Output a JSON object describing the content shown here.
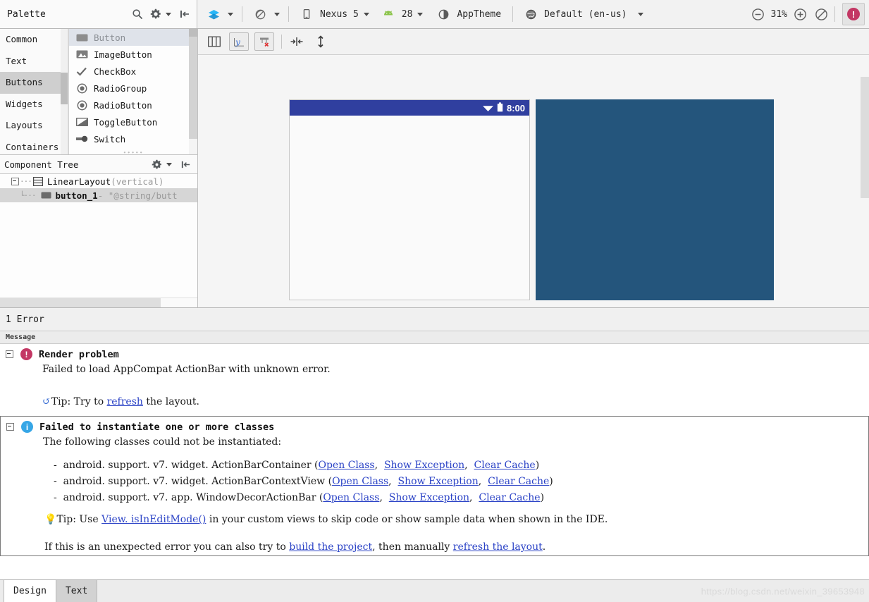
{
  "palette": {
    "title": "Palette",
    "icons": {
      "search": "search-icon",
      "gear": "gear-icon",
      "collapse": "collapse-panel-icon"
    },
    "categories": [
      {
        "label": "Common",
        "selected": false
      },
      {
        "label": "Text",
        "selected": false
      },
      {
        "label": "Buttons",
        "selected": true
      },
      {
        "label": "Widgets",
        "selected": false
      },
      {
        "label": "Layouts",
        "selected": false
      },
      {
        "label": "Containers",
        "selected": false
      }
    ],
    "widgets": [
      {
        "label": "Button",
        "icon": "button-icon",
        "selected": true
      },
      {
        "label": "ImageButton",
        "icon": "image-button-icon",
        "selected": false
      },
      {
        "label": "CheckBox",
        "icon": "checkbox-icon",
        "selected": false
      },
      {
        "label": "RadioGroup",
        "icon": "radio-group-icon",
        "selected": false
      },
      {
        "label": "RadioButton",
        "icon": "radio-button-icon",
        "selected": false
      },
      {
        "label": "ToggleButton",
        "icon": "toggle-button-icon",
        "selected": false
      },
      {
        "label": "Switch",
        "icon": "switch-icon",
        "selected": false
      }
    ]
  },
  "component_tree": {
    "title": "Component Tree",
    "nodes": [
      {
        "name": "LinearLayout",
        "detail": " (vertical)",
        "selected": false,
        "depth": 0,
        "bold": false
      },
      {
        "name": "button_1",
        "detail": " - \"@string/butt",
        "selected": true,
        "depth": 1,
        "bold": true
      }
    ]
  },
  "toolbar": {
    "layers_label": "layers-icon",
    "orientation_label": "orientation-icon",
    "device": "Nexus 5",
    "api_level": "28",
    "theme": "AppTheme",
    "locale": "Default (en-us)",
    "zoom": "31%",
    "zoom_out": "zoom-out-icon",
    "zoom_in": "zoom-in-icon",
    "zoom_fit": "zoom-reset-icon",
    "error_count_badge": "!"
  },
  "design_toolbar": {
    "buttons": [
      {
        "name": "view-mode-icon",
        "label": ""
      },
      {
        "name": "blueprint-mode-icon",
        "label": ""
      },
      {
        "name": "clear-constraints-icon",
        "label": ""
      },
      {
        "name": "horizontal-margin-icon",
        "label": ""
      },
      {
        "name": "vertical-margin-icon",
        "label": ""
      }
    ]
  },
  "preview": {
    "status_bar_time": "8:00",
    "status_bar_color": "#303f9f",
    "device_bg": "#fafafa",
    "blueprint_color": "#24557c"
  },
  "errors": {
    "summary": "1 Error",
    "column_header": "Message",
    "blocks": [
      {
        "severity": "error",
        "title": "Render problem",
        "lines": [
          {
            "type": "text",
            "text": "Failed to load AppCompat ActionBar with unknown error."
          },
          {
            "type": "blank"
          },
          {
            "type": "tip_refresh",
            "prefix": "Tip: Try to ",
            "link": "refresh",
            "suffix": " the layout."
          }
        ]
      },
      {
        "severity": "info",
        "title": "Failed to instantiate one or more classes",
        "lines": [
          {
            "type": "text",
            "text": "The following classes could not be instantiated:"
          },
          {
            "type": "blank"
          },
          {
            "type": "class",
            "dash": "-",
            "cls": "android. support. v7. widget. ActionBarContainer",
            "links": [
              "Open Class",
              "Show Exception",
              "Clear Cache"
            ]
          },
          {
            "type": "class",
            "dash": "-",
            "cls": "android. support. v7. widget. ActionBarContextView",
            "links": [
              "Open Class",
              "Show Exception",
              "Clear Cache"
            ]
          },
          {
            "type": "class",
            "dash": "-",
            "cls": "android. support. v7. app. WindowDecorActionBar",
            "links": [
              "Open Class",
              "Show Exception",
              "Clear Cache"
            ]
          },
          {
            "type": "bulb_tip",
            "prefix": "Tip: Use ",
            "link": "View. isInEditMode()",
            "suffix": " in your custom views to skip code or show sample data when shown in the IDE."
          },
          {
            "type": "blank"
          },
          {
            "type": "build_tip",
            "prefix": "If this is an unexpected error you can also try to ",
            "link1": "build the project",
            "mid": ", then manually ",
            "link2": "refresh the layout",
            "suffix": "."
          }
        ]
      }
    ]
  },
  "bottom_tabs": [
    {
      "label": "Design",
      "active": true
    },
    {
      "label": "Text",
      "active": false
    }
  ],
  "watermark": "https://blog.csdn.net/weixin_39653948"
}
